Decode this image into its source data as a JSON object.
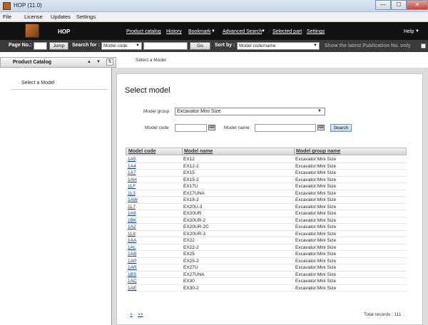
{
  "window": {
    "title": "HOP (11.0)",
    "minimize": "—",
    "maximize": "☐",
    "close": "✕"
  },
  "menu": [
    "File",
    "License",
    "Updates",
    "Settings"
  ],
  "header": {
    "app_name": "HOP",
    "links": [
      "Product catalog",
      "History",
      "Bookmark",
      "Advanced Search",
      "Selected part",
      "Settings"
    ],
    "help": "Help"
  },
  "toolbar": {
    "page_no_label": "Page No.:",
    "page_no_value": "",
    "jump_label": "Jump",
    "search_for_label": "Search for :",
    "search_field": "Model code",
    "search_value": "",
    "go_label": "Go",
    "sort_by_label": "Sort by :",
    "sort_value": "Model code/name",
    "latest_label": "Show the latest Publication No. only"
  },
  "left_pane": {
    "title": "Product Catalog",
    "item": "Select a Model"
  },
  "breadcrumb": "Select a Model",
  "main": {
    "title": "Select model",
    "model_group_label": "Model group",
    "model_group_value": "Excavator:Mini Size",
    "model_code_label": "Model code",
    "model_code_value": "",
    "model_name_label": "Model name",
    "model_name_value": "",
    "search_label": "Search"
  },
  "table": {
    "headers": [
      "Model code",
      "Model name",
      "Model group name"
    ],
    "rows": [
      [
        "1A5",
        "EX12",
        "Excavator:Mini Size"
      ],
      [
        "1A4",
        "EX12-2",
        "Excavator:Mini Size"
      ],
      [
        "1A7",
        "EX15",
        "Excavator:Mini Size"
      ],
      [
        "1AH",
        "EX15-2",
        "Excavator:Mini Size"
      ],
      [
        "1LF",
        "EX17U",
        "Excavator:Mini Size"
      ],
      [
        "1L3",
        "EX17UNA",
        "Excavator:Mini Size"
      ],
      [
        "1AW",
        "EX18-2",
        "Excavator:Mini Size"
      ],
      [
        "1L7",
        "EX20U-3",
        "Excavator:Mini Size"
      ],
      [
        "1A9",
        "EX20UR",
        "Excavator:Mini Size"
      ],
      [
        "1BK",
        "EX20UR-2",
        "Excavator:Mini Size"
      ],
      [
        "1A2",
        "EX20UR-2C",
        "Excavator:Mini Size"
      ],
      [
        "1L8",
        "EX20UR-3",
        "Excavator:Mini Size"
      ],
      [
        "1AA",
        "EX22",
        "Excavator:Mini Size"
      ],
      [
        "1AL",
        "EX22-2",
        "Excavator:Mini Size"
      ],
      [
        "1AB",
        "EX25",
        "Excavator:Mini Size"
      ],
      [
        "1AP",
        "EX25-2",
        "Excavator:Mini Size"
      ],
      [
        "1AR",
        "EX27U",
        "Excavator:Mini Size"
      ],
      [
        "1BS",
        "EX27UNA",
        "Excavator:Mini Size"
      ],
      [
        "1AC",
        "EX30",
        "Excavator:Mini Size"
      ],
      [
        "1AE",
        "EX30-2",
        "Excavator:Mini Size"
      ]
    ]
  },
  "pager": {
    "next": ">",
    "last": ">>",
    "total": "Total records : 111"
  }
}
